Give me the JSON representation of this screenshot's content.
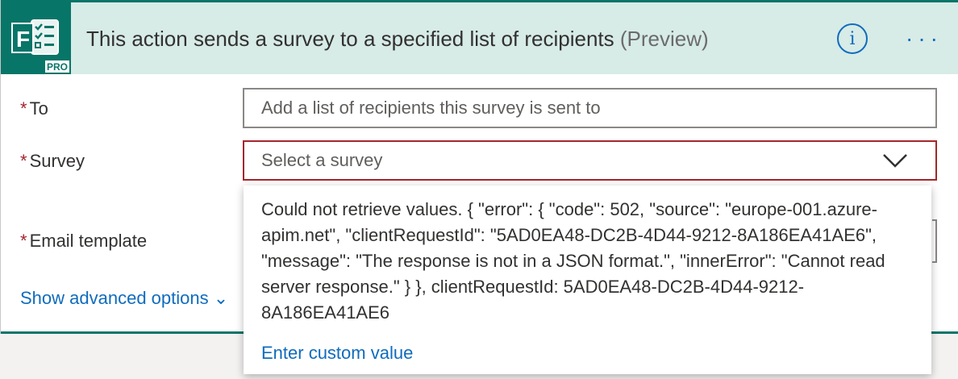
{
  "header": {
    "title": "This action sends a survey to a specified list of recipients",
    "preview": "(Preview)",
    "logo_letter": "F",
    "logo_badge": "PRO",
    "info_icon": "info-icon",
    "more_icon": "more-options-icon"
  },
  "fields": {
    "to": {
      "label": "To",
      "required_mark": "*",
      "placeholder": "Add a list of recipients this survey is sent to"
    },
    "survey": {
      "label": "Survey",
      "required_mark": "*",
      "placeholder": "Select a survey"
    },
    "email_template": {
      "label": "Email template",
      "required_mark": "*"
    }
  },
  "advanced": {
    "label": "Show advanced options",
    "icon": "chevron-down-icon"
  },
  "dropdown": {
    "error_message": "Could not retrieve values. { \"error\": { \"code\": 502, \"source\": \"europe-001.azure-apim.net\", \"clientRequestId\": \"5AD0EA48-DC2B-4D44-9212-8A186EA41AE6\", \"message\": \"The response is not in a JSON format.\", \"innerError\": \"Cannot read server response.\" } }, clientRequestId: 5AD0EA48-DC2B-4D44-9212-8A186EA41AE6",
    "custom_value_label": "Enter custom value"
  },
  "colors": {
    "brand": "#077568",
    "header_bg": "#d7ebe7",
    "link": "#0f6cbd",
    "error_border": "#a4262c"
  }
}
